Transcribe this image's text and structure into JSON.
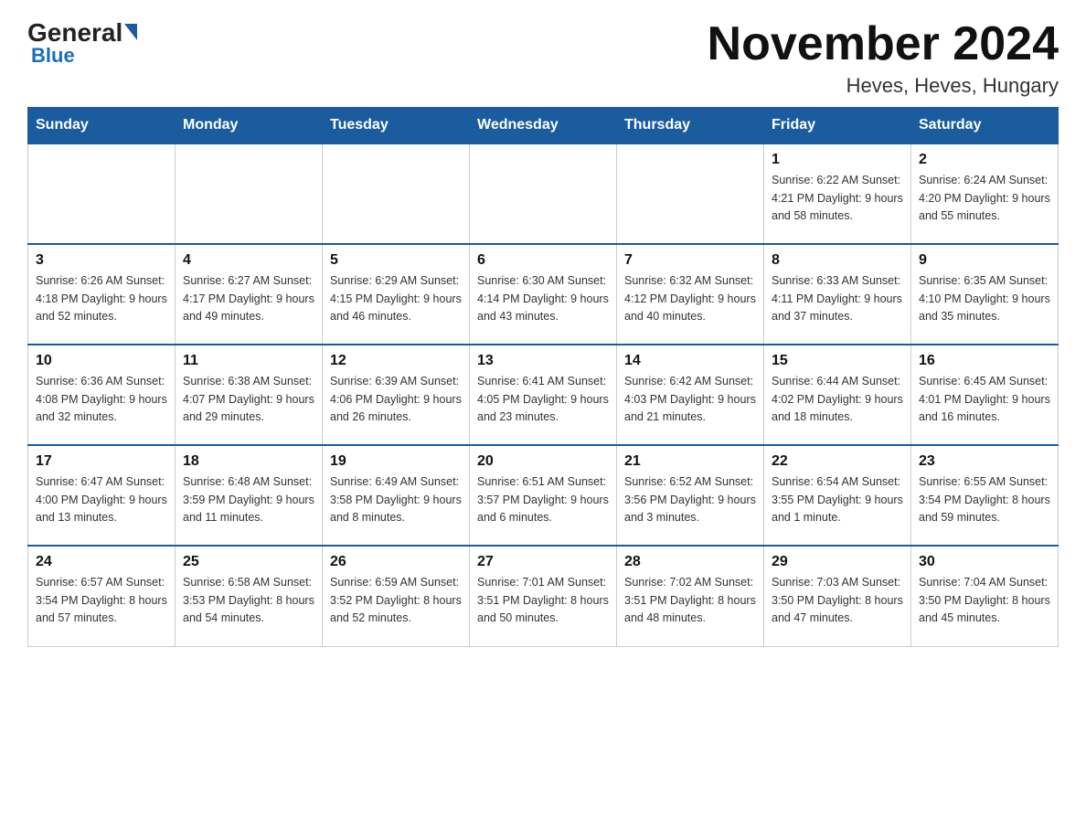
{
  "header": {
    "logo_general": "General",
    "logo_blue": "Blue",
    "title": "November 2024",
    "subtitle": "Heves, Heves, Hungary"
  },
  "weekdays": [
    "Sunday",
    "Monday",
    "Tuesday",
    "Wednesday",
    "Thursday",
    "Friday",
    "Saturday"
  ],
  "weeks": [
    [
      {
        "day": "",
        "info": ""
      },
      {
        "day": "",
        "info": ""
      },
      {
        "day": "",
        "info": ""
      },
      {
        "day": "",
        "info": ""
      },
      {
        "day": "",
        "info": ""
      },
      {
        "day": "1",
        "info": "Sunrise: 6:22 AM\nSunset: 4:21 PM\nDaylight: 9 hours\nand 58 minutes."
      },
      {
        "day": "2",
        "info": "Sunrise: 6:24 AM\nSunset: 4:20 PM\nDaylight: 9 hours\nand 55 minutes."
      }
    ],
    [
      {
        "day": "3",
        "info": "Sunrise: 6:26 AM\nSunset: 4:18 PM\nDaylight: 9 hours\nand 52 minutes."
      },
      {
        "day": "4",
        "info": "Sunrise: 6:27 AM\nSunset: 4:17 PM\nDaylight: 9 hours\nand 49 minutes."
      },
      {
        "day": "5",
        "info": "Sunrise: 6:29 AM\nSunset: 4:15 PM\nDaylight: 9 hours\nand 46 minutes."
      },
      {
        "day": "6",
        "info": "Sunrise: 6:30 AM\nSunset: 4:14 PM\nDaylight: 9 hours\nand 43 minutes."
      },
      {
        "day": "7",
        "info": "Sunrise: 6:32 AM\nSunset: 4:12 PM\nDaylight: 9 hours\nand 40 minutes."
      },
      {
        "day": "8",
        "info": "Sunrise: 6:33 AM\nSunset: 4:11 PM\nDaylight: 9 hours\nand 37 minutes."
      },
      {
        "day": "9",
        "info": "Sunrise: 6:35 AM\nSunset: 4:10 PM\nDaylight: 9 hours\nand 35 minutes."
      }
    ],
    [
      {
        "day": "10",
        "info": "Sunrise: 6:36 AM\nSunset: 4:08 PM\nDaylight: 9 hours\nand 32 minutes."
      },
      {
        "day": "11",
        "info": "Sunrise: 6:38 AM\nSunset: 4:07 PM\nDaylight: 9 hours\nand 29 minutes."
      },
      {
        "day": "12",
        "info": "Sunrise: 6:39 AM\nSunset: 4:06 PM\nDaylight: 9 hours\nand 26 minutes."
      },
      {
        "day": "13",
        "info": "Sunrise: 6:41 AM\nSunset: 4:05 PM\nDaylight: 9 hours\nand 23 minutes."
      },
      {
        "day": "14",
        "info": "Sunrise: 6:42 AM\nSunset: 4:03 PM\nDaylight: 9 hours\nand 21 minutes."
      },
      {
        "day": "15",
        "info": "Sunrise: 6:44 AM\nSunset: 4:02 PM\nDaylight: 9 hours\nand 18 minutes."
      },
      {
        "day": "16",
        "info": "Sunrise: 6:45 AM\nSunset: 4:01 PM\nDaylight: 9 hours\nand 16 minutes."
      }
    ],
    [
      {
        "day": "17",
        "info": "Sunrise: 6:47 AM\nSunset: 4:00 PM\nDaylight: 9 hours\nand 13 minutes."
      },
      {
        "day": "18",
        "info": "Sunrise: 6:48 AM\nSunset: 3:59 PM\nDaylight: 9 hours\nand 11 minutes."
      },
      {
        "day": "19",
        "info": "Sunrise: 6:49 AM\nSunset: 3:58 PM\nDaylight: 9 hours\nand 8 minutes."
      },
      {
        "day": "20",
        "info": "Sunrise: 6:51 AM\nSunset: 3:57 PM\nDaylight: 9 hours\nand 6 minutes."
      },
      {
        "day": "21",
        "info": "Sunrise: 6:52 AM\nSunset: 3:56 PM\nDaylight: 9 hours\nand 3 minutes."
      },
      {
        "day": "22",
        "info": "Sunrise: 6:54 AM\nSunset: 3:55 PM\nDaylight: 9 hours\nand 1 minute."
      },
      {
        "day": "23",
        "info": "Sunrise: 6:55 AM\nSunset: 3:54 PM\nDaylight: 8 hours\nand 59 minutes."
      }
    ],
    [
      {
        "day": "24",
        "info": "Sunrise: 6:57 AM\nSunset: 3:54 PM\nDaylight: 8 hours\nand 57 minutes."
      },
      {
        "day": "25",
        "info": "Sunrise: 6:58 AM\nSunset: 3:53 PM\nDaylight: 8 hours\nand 54 minutes."
      },
      {
        "day": "26",
        "info": "Sunrise: 6:59 AM\nSunset: 3:52 PM\nDaylight: 8 hours\nand 52 minutes."
      },
      {
        "day": "27",
        "info": "Sunrise: 7:01 AM\nSunset: 3:51 PM\nDaylight: 8 hours\nand 50 minutes."
      },
      {
        "day": "28",
        "info": "Sunrise: 7:02 AM\nSunset: 3:51 PM\nDaylight: 8 hours\nand 48 minutes."
      },
      {
        "day": "29",
        "info": "Sunrise: 7:03 AM\nSunset: 3:50 PM\nDaylight: 8 hours\nand 47 minutes."
      },
      {
        "day": "30",
        "info": "Sunrise: 7:04 AM\nSunset: 3:50 PM\nDaylight: 8 hours\nand 45 minutes."
      }
    ]
  ]
}
